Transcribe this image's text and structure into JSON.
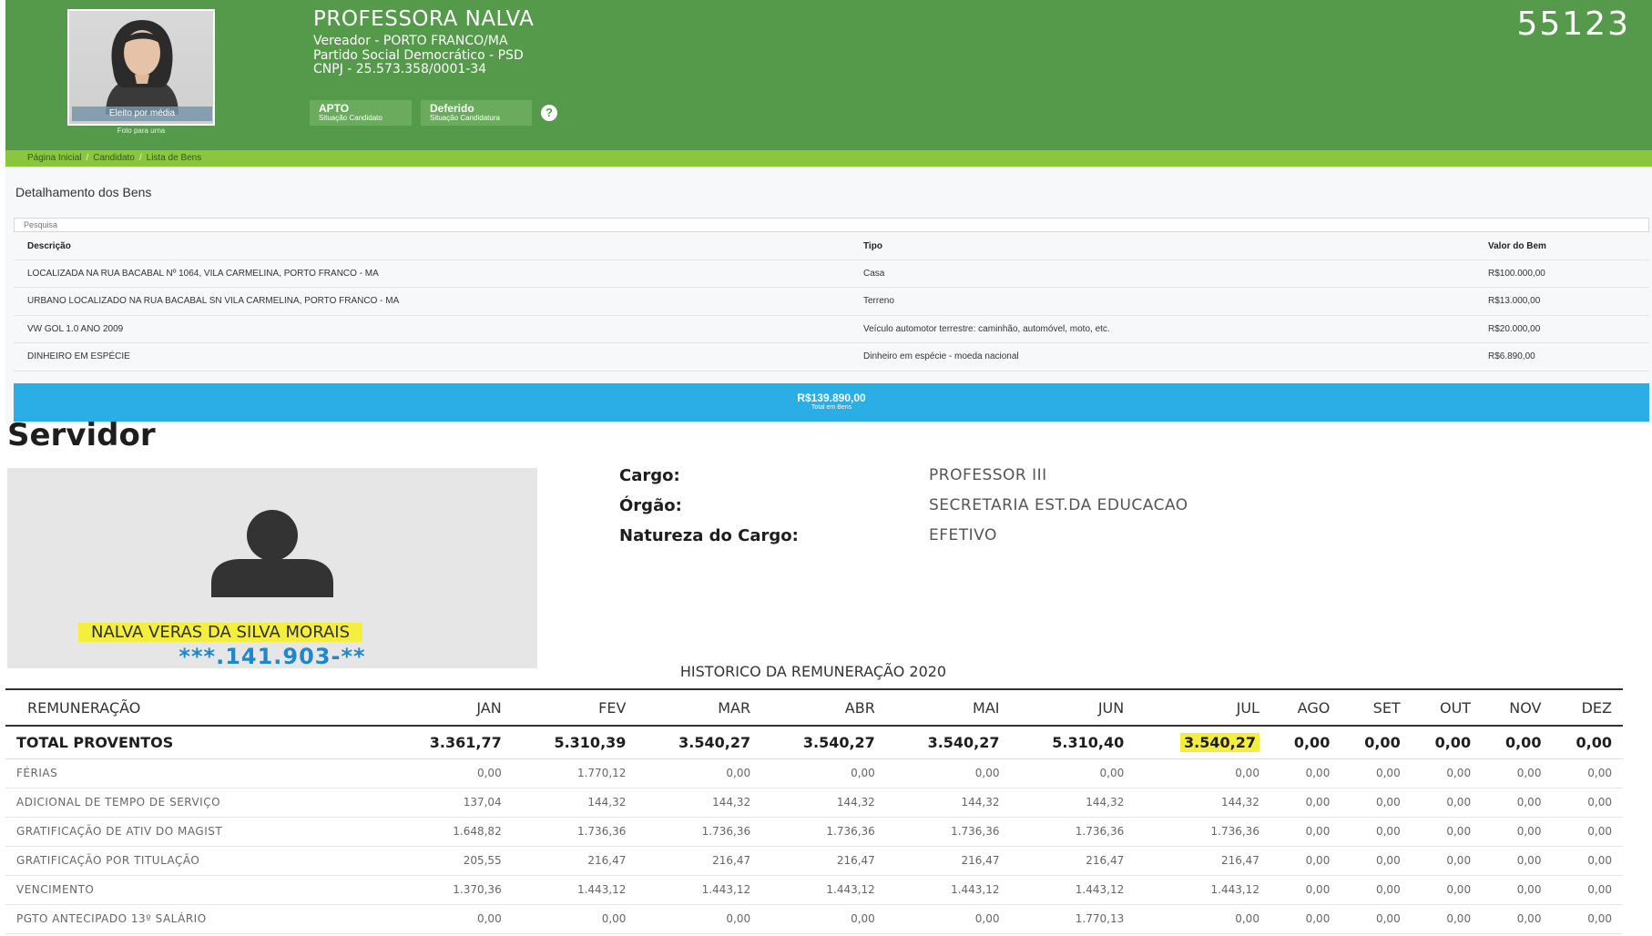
{
  "candidate": {
    "photo_caption": "Eleito por média",
    "photo_sub": "Foto para urna",
    "name": "PROFESSORA NALVA",
    "role": "Vereador - PORTO FRANCO/MA",
    "party": "Partido Social Democrático - PSD",
    "cnpj": "CNPJ - 25.573.358/0001-34",
    "number": "55123",
    "badges": [
      {
        "title": "APTO",
        "sub": "Situação Candidato"
      },
      {
        "title": "Deferido",
        "sub": "Situação Candidatura"
      }
    ],
    "help": "?"
  },
  "breadcrumb": [
    "Página Inicial",
    "Candidato",
    "Lista de Bens"
  ],
  "bens": {
    "title": "Detalhamento dos Bens",
    "search_placeholder": "Pesquisa",
    "headers": [
      "Descrição",
      "Tipo",
      "Valor do Bem"
    ],
    "rows": [
      [
        "LOCALIZADA NA RUA BACABAL Nº 1064, VILA CARMELINA, PORTO FRANCO - MA",
        "Casa",
        "R$100.000,00"
      ],
      [
        "URBANO LOCALIZADO NA RUA BACABAL SN VILA CARMELINA, PORTO FRANCO - MA",
        "Terreno",
        "R$13.000,00"
      ],
      [
        "VW GOL 1.0 ANO 2009",
        "Veículo automotor terrestre: caminhão, automóvel, moto, etc.",
        "R$20.000,00"
      ],
      [
        "DINHEIRO EM ESPÉCIE",
        "Dinheiro em espécie - moeda nacional",
        "R$6.890,00"
      ]
    ],
    "total_value": "R$139.890,00",
    "total_label": "Total em Bens"
  },
  "servidor": {
    "title": "Servidor",
    "name": "NALVA VERAS DA SILVA MORAIS",
    "cpf": "***.141.903-**",
    "fields": [
      {
        "label": "Cargo:",
        "value": "PROFESSOR III"
      },
      {
        "label": "Órgão:",
        "value": "SECRETARIA EST.DA EDUCACAO"
      },
      {
        "label": "Natureza do Cargo:",
        "value": "EFETIVO"
      }
    ]
  },
  "remuneracao": {
    "title": "HISTORICO DA REMUNERAÇÃO 2020",
    "headers": [
      "REMUNERAÇÃO",
      "JAN",
      "FEV",
      "MAR",
      "ABR",
      "MAI",
      "JUN",
      "JUL",
      "AGO",
      "SET",
      "OUT",
      "NOV",
      "DEZ"
    ],
    "total": [
      "TOTAL PROVENTOS",
      "3.361,77",
      "5.310,39",
      "3.540,27",
      "3.540,27",
      "3.540,27",
      "5.310,40",
      "3.540,27",
      "0,00",
      "0,00",
      "0,00",
      "0,00",
      "0,00"
    ],
    "highlight_col": 7,
    "rows": [
      [
        "FÉRIAS",
        "0,00",
        "1.770,12",
        "0,00",
        "0,00",
        "0,00",
        "0,00",
        "0,00",
        "0,00",
        "0,00",
        "0,00",
        "0,00",
        "0,00"
      ],
      [
        "ADICIONAL DE TEMPO DE SERVIÇO",
        "137,04",
        "144,32",
        "144,32",
        "144,32",
        "144,32",
        "144,32",
        "144,32",
        "0,00",
        "0,00",
        "0,00",
        "0,00",
        "0,00"
      ],
      [
        "GRATIFICAÇÃO DE ATIV DO MAGIST",
        "1.648,82",
        "1.736,36",
        "1.736,36",
        "1.736,36",
        "1.736,36",
        "1.736,36",
        "1.736,36",
        "0,00",
        "0,00",
        "0,00",
        "0,00",
        "0,00"
      ],
      [
        "GRATIFICAÇÃO POR TITULAÇÃO",
        "205,55",
        "216,47",
        "216,47",
        "216,47",
        "216,47",
        "216,47",
        "216,47",
        "0,00",
        "0,00",
        "0,00",
        "0,00",
        "0,00"
      ],
      [
        "VENCIMENTO",
        "1.370,36",
        "1.443,12",
        "1.443,12",
        "1.443,12",
        "1.443,12",
        "1.443,12",
        "1.443,12",
        "0,00",
        "0,00",
        "0,00",
        "0,00",
        "0,00"
      ],
      [
        "PGTO ANTECIPADO 13º SALÁRIO",
        "0,00",
        "0,00",
        "0,00",
        "0,00",
        "0,00",
        "1.770,13",
        "0,00",
        "0,00",
        "0,00",
        "0,00",
        "0,00",
        "0,00"
      ]
    ]
  },
  "colors": {
    "header_green": "#55994a",
    "breadcrumb_green": "#8cc63f",
    "total_blue": "#2baee6",
    "highlight_yellow": "#f4ef3f",
    "cpf_blue": "#1e88c8"
  }
}
